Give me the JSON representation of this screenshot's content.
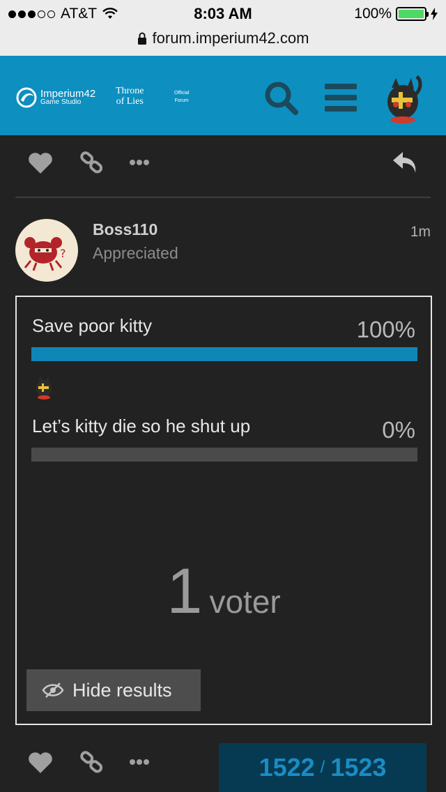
{
  "status_bar": {
    "carrier": "AT&T",
    "time": "8:03 AM",
    "battery": "100%",
    "url": "forum.imperium42.com"
  },
  "header": {
    "brand_name": "Imperium42",
    "brand_sub": "Game Studio",
    "game_line1": "Throne",
    "game_line2": "of Lies",
    "official_line1": "Official",
    "official_line2": "Forum",
    "accent_color": "#0d8fc0"
  },
  "post": {
    "username": "Boss110",
    "user_title": "Appreciated",
    "time": "1m"
  },
  "poll": {
    "options": [
      {
        "label": "Save poor kitty",
        "percent": "100%",
        "fraction": 1.0
      },
      {
        "label": "Let’s kitty die so he shut up",
        "percent": "0%",
        "fraction": 0.0
      }
    ],
    "voter_count": "1",
    "voter_word": "voter",
    "hide_label": "Hide results"
  },
  "progress": {
    "current": "1522",
    "separator": "/",
    "total": "1523"
  },
  "icons": [
    "heart-icon",
    "link-icon",
    "more-icon",
    "reply-icon",
    "search-icon",
    "menu-icon",
    "eye-slash-icon",
    "lock-icon",
    "wifi-icon",
    "charging-icon"
  ]
}
